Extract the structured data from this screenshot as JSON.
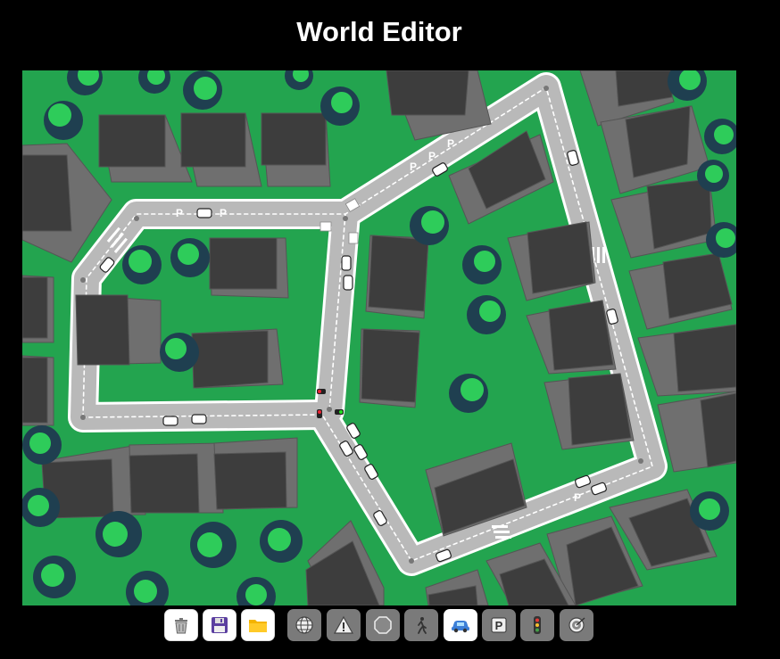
{
  "app": {
    "title": "World Editor"
  },
  "world": {
    "road_marking_label": "P"
  },
  "toolbar": {
    "file_buttons": [
      {
        "name": "trash-icon",
        "tooltip": "Dispose"
      },
      {
        "name": "save-icon",
        "tooltip": "Save"
      },
      {
        "name": "folder-icon",
        "tooltip": "Load"
      }
    ],
    "mode_buttons": [
      {
        "name": "globe-icon",
        "label": "graph",
        "active": false
      },
      {
        "name": "warning-icon",
        "label": "yield",
        "active": false
      },
      {
        "name": "stop-icon",
        "label": "stop",
        "active": false
      },
      {
        "name": "pedestrian-icon",
        "label": "crossing",
        "active": false
      },
      {
        "name": "car-icon",
        "label": "start",
        "active": true
      },
      {
        "name": "parking-icon",
        "label": "P",
        "active": false
      },
      {
        "name": "traffic-light-icon",
        "label": "light",
        "active": false
      },
      {
        "name": "target-icon",
        "label": "target",
        "active": false
      }
    ]
  },
  "colors": {
    "background": "#000000",
    "grass": "#23a44f",
    "road": "#bbbbbb",
    "road_edge": "#ffffff",
    "building_roof": "#3d3d3d",
    "building_wall": "#6f6f6f",
    "tree_dark": "#1f3f50",
    "tree_light": "#2ecc5a"
  }
}
